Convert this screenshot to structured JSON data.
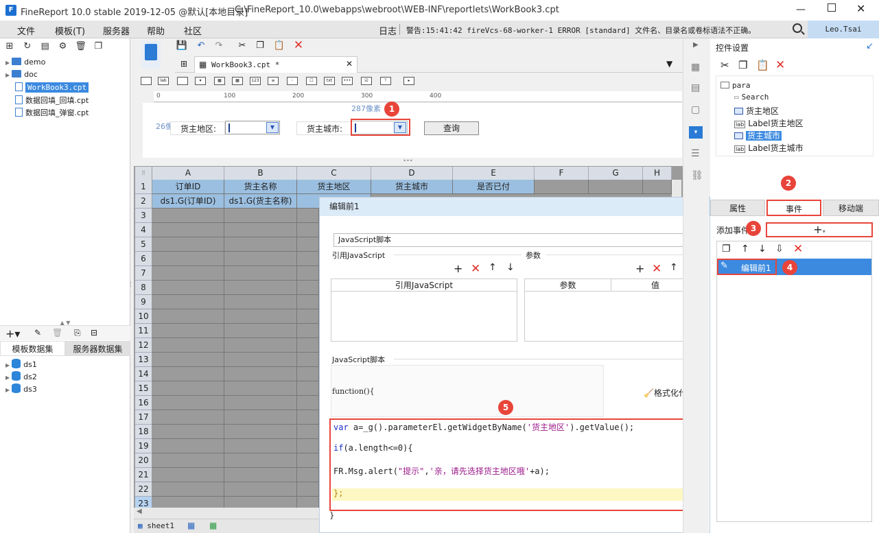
{
  "titlebar": {
    "app_title": "FineReport 10.0 stable 2019-12-05 @默认[本地目录]",
    "file_path": "C:\\FineReport_10.0\\webapps\\webroot\\WEB-INF\\reportlets\\WorkBook3.cpt"
  },
  "menubar": {
    "items": [
      "文件",
      "模板(T)",
      "服务器",
      "帮助",
      "社区"
    ],
    "log_label": "日志",
    "log_message": "警告:15:41:42 fireVcs-68-worker-1 ERROR [standard] 文件名、目录名或卷标语法不正确。",
    "user": "Leo.Tsai"
  },
  "file_tree": {
    "items": [
      {
        "label": "demo",
        "type": "folder"
      },
      {
        "label": "doc",
        "type": "folder"
      },
      {
        "label": "WorkBook3.cpt",
        "type": "file",
        "selected": true
      },
      {
        "label": "数据回填_回填.cpt",
        "type": "file"
      },
      {
        "label": "数据回填_弹窗.cpt",
        "type": "file"
      }
    ]
  },
  "dataset_panel": {
    "tabs": [
      "模板数据集",
      "服务器数据集"
    ],
    "items": [
      "ds1",
      "ds2",
      "ds3"
    ]
  },
  "editor": {
    "tab_label": "WorkBook3.cpt *",
    "ruler_ticks": [
      "0",
      "100",
      "200",
      "300",
      "400"
    ],
    "size_label_h": "287像素",
    "size_label_v": "26像素",
    "param_labels": {
      "region": "货主地区:",
      "city": "货主城市:"
    },
    "query_button": "查询"
  },
  "sheet": {
    "columns": [
      "A",
      "B",
      "C",
      "D",
      "E",
      "F",
      "G",
      "H"
    ],
    "header_row": [
      "订单ID",
      "货主名称",
      "货主地区",
      "货主城市",
      "是否已付"
    ],
    "data_row": [
      "ds1.G(订单ID)",
      "ds1.G(货主名称)",
      "ds1."
    ],
    "row_numbers": [
      "1",
      "2",
      "3",
      "4",
      "5",
      "6",
      "7",
      "8",
      "9",
      "10",
      "11",
      "12",
      "13",
      "14",
      "15",
      "16",
      "17",
      "18",
      "19",
      "20",
      "21",
      "22",
      "23"
    ],
    "sheet_tab": "sheet1"
  },
  "dialog": {
    "title": "编辑前1",
    "script_type": "JavaScript脚本",
    "ref_js_section": "引用JavaScript",
    "params_section": "参数",
    "ref_js_col": "引用JavaScript",
    "param_col": "参数",
    "value_col": "值",
    "script_section": "JavaScript脚本",
    "function_header": "function(){",
    "format_code": "格式化代码",
    "closing_brace": "}",
    "code_lines": [
      "var a=_g().parameterEl.getWidgetByName('货主地区').getValue();",
      "if(a.length<=0){",
      "FR.Msg.alert(\"提示\",'亲，请先选择货主地区哦'+a);",
      "};"
    ]
  },
  "right_panel": {
    "title": "控件设置",
    "tree_root": "para",
    "tree_items": [
      "Search",
      "货主地区",
      "Label货主地区",
      "货主城市",
      "Label货主城市"
    ],
    "tabs": [
      "属性",
      "事件",
      "移动端"
    ],
    "add_event_label": "添加事件",
    "event_item": "编辑前1"
  },
  "badges": [
    "1",
    "2",
    "3",
    "4",
    "5"
  ]
}
